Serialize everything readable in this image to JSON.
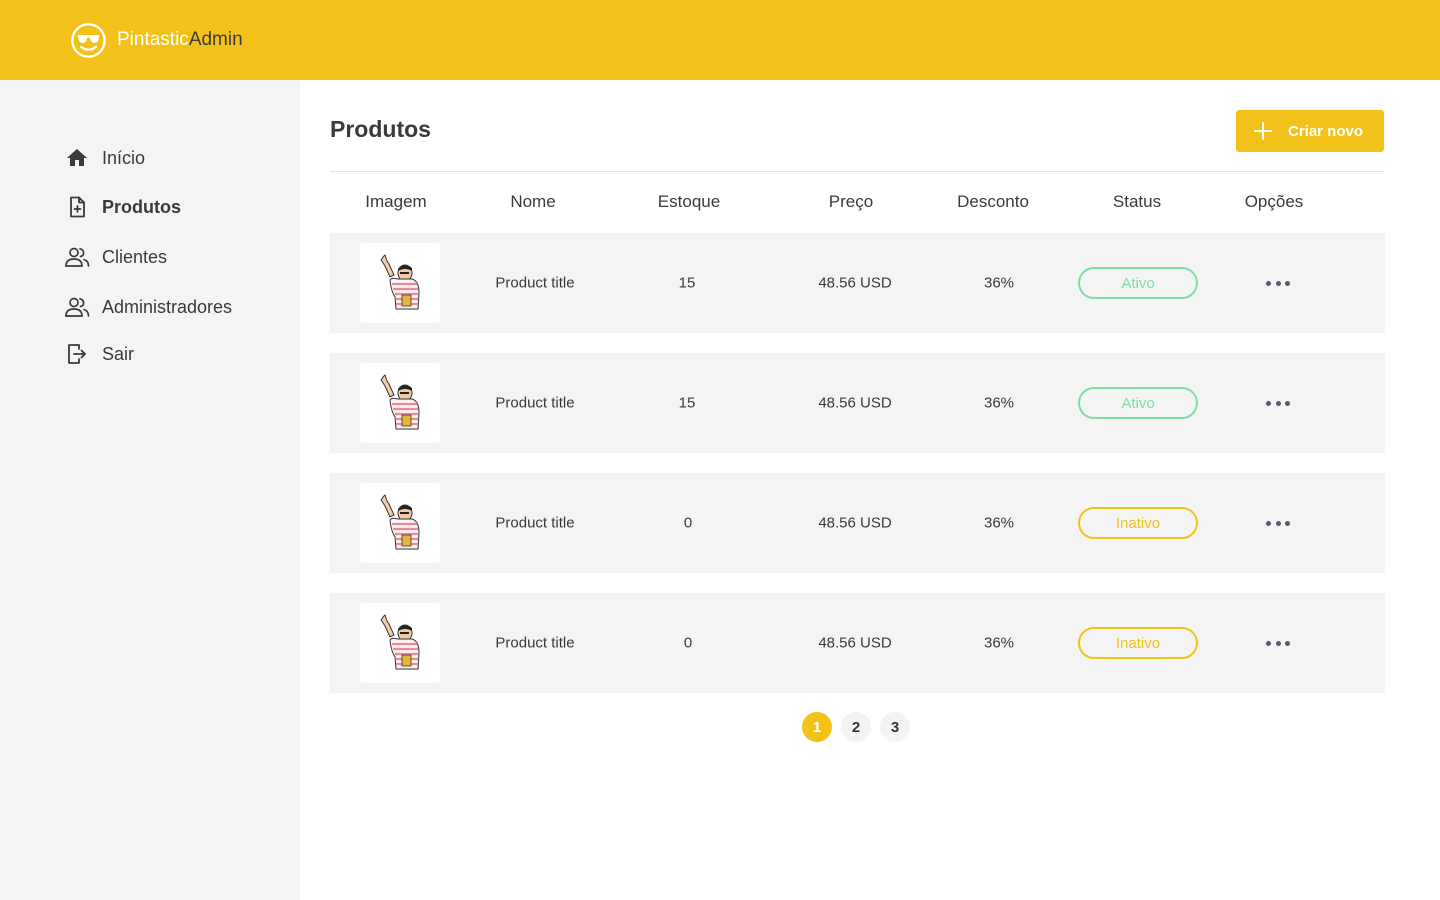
{
  "brand": {
    "part1": "Pintastic",
    "part2": "Admin",
    "accent": "#F2C11A"
  },
  "sidebar": {
    "items": [
      {
        "label": "Início",
        "icon": "home-icon"
      },
      {
        "label": "Produtos",
        "icon": "document-add-icon",
        "active": true
      },
      {
        "label": "Clientes",
        "icon": "users-icon"
      },
      {
        "label": "Administradores",
        "icon": "users-icon"
      },
      {
        "label": "Sair",
        "icon": "logout-icon"
      }
    ]
  },
  "main": {
    "title": "Produtos",
    "create_button": "Criar novo",
    "columns": [
      "Imagem",
      "Nome",
      "Estoque",
      "Preço",
      "Desconto",
      "Status",
      "Opções"
    ],
    "rows": [
      {
        "name": "Product title",
        "stock": "15",
        "price": "48.56 USD",
        "discount": "36%",
        "status": "Ativo"
      },
      {
        "name": "Product title",
        "stock": "15",
        "price": "48.56 USD",
        "discount": "36%",
        "status": "Ativo"
      },
      {
        "name": "Product title",
        "stock": "0",
        "price": "48.56 USD",
        "discount": "36%",
        "status": "Inativo"
      },
      {
        "name": "Product title",
        "stock": "0",
        "price": "48.56 USD",
        "discount": "36%",
        "status": "Inativo"
      }
    ],
    "status_colors": {
      "Ativo": "#7FDEA6",
      "Inativo": "#F2C11A"
    },
    "pagination": {
      "pages": [
        "1",
        "2",
        "3"
      ],
      "current": "1"
    }
  }
}
